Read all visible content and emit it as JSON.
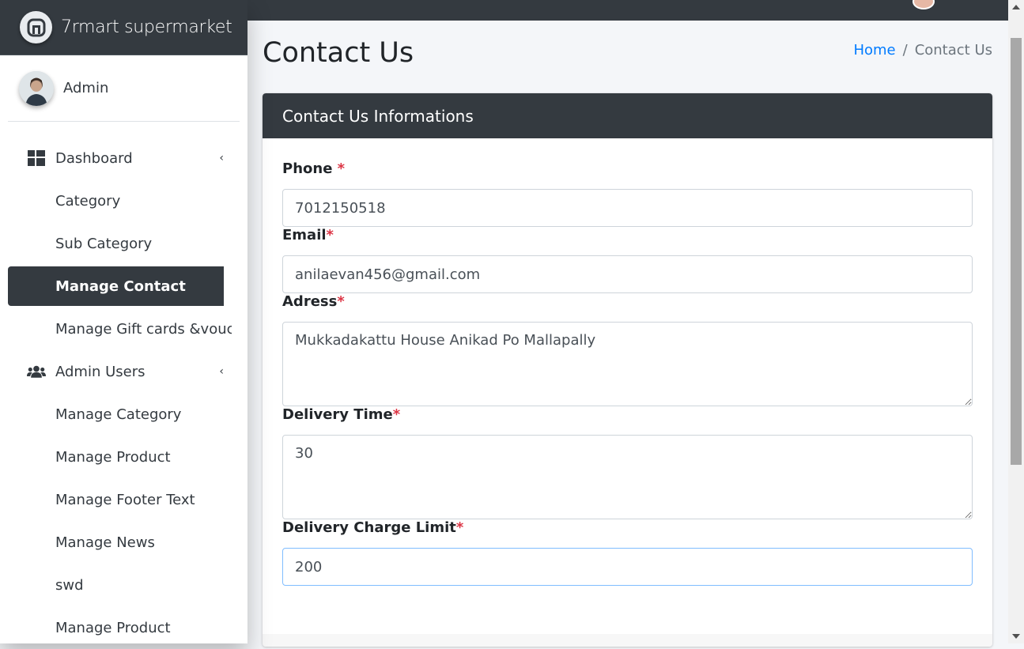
{
  "brand": {
    "name": "7rmart supermarket",
    "logo_icon": "7rmart-logo-icon"
  },
  "user": {
    "name": "Admin"
  },
  "sidebar": {
    "items": [
      {
        "label": "Dashboard",
        "icon": "dashboard-icon",
        "caret": "‹"
      },
      {
        "label": "Category"
      },
      {
        "label": "Sub Category"
      },
      {
        "label": "Manage Contact",
        "active": true
      },
      {
        "label": "Manage Gift cards &vouchers"
      },
      {
        "label": "Admin Users",
        "icon": "users-icon",
        "caret": "‹"
      },
      {
        "label": "Manage Category"
      },
      {
        "label": "Manage Product"
      },
      {
        "label": "Manage Footer Text"
      },
      {
        "label": "Manage News"
      },
      {
        "label": "swd"
      },
      {
        "label": "Manage Product"
      }
    ]
  },
  "page": {
    "title": "Contact Us",
    "breadcrumb": {
      "home": "Home",
      "separator": "/",
      "current": "Contact Us"
    }
  },
  "form": {
    "header": "Contact Us Informations",
    "required_mark": "*",
    "phone": {
      "label": "Phone ",
      "value": "7012150518"
    },
    "email": {
      "label": "Email",
      "value": "anilaevan456@gmail.com"
    },
    "address": {
      "label": "Adress",
      "value": "Mukkadakattu House Anikad Po Mallapally"
    },
    "delivery_time": {
      "label": "Delivery Time",
      "value": "30"
    },
    "delivery_charge_limit": {
      "label": "Delivery Charge Limit",
      "value": "200"
    }
  },
  "colors": {
    "dark": "#343a40",
    "link": "#007bff",
    "required": "#dc3545",
    "focus_border": "#80bdff"
  }
}
